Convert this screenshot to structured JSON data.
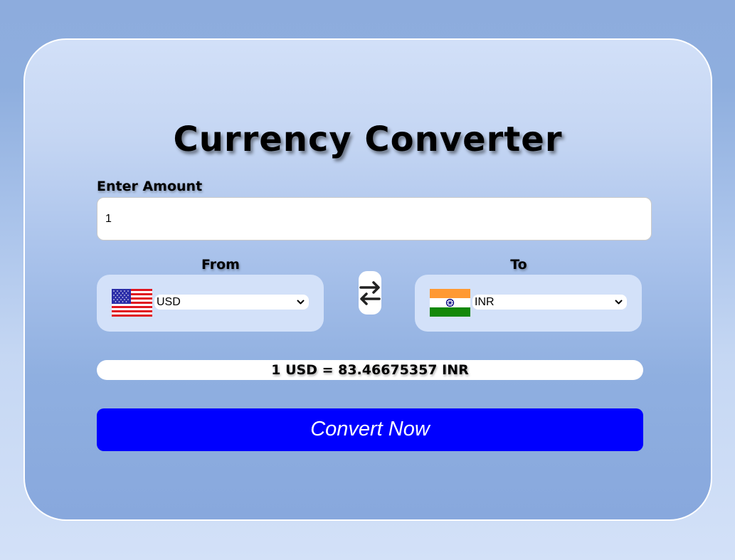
{
  "app": {
    "title": "Currency Converter"
  },
  "amount": {
    "label": "Enter Amount",
    "value": "1"
  },
  "from": {
    "label": "From",
    "currency": "USD",
    "flag_icon": "us-flag-icon"
  },
  "to": {
    "label": "To",
    "currency": "INR",
    "flag_icon": "india-flag-icon"
  },
  "swap": {
    "icon": "swap-arrows-icon"
  },
  "result": {
    "text": "1 USD = 83.46675357 INR"
  },
  "convert": {
    "label": "Convert Now"
  },
  "colors": {
    "button_bg": "#0000ff",
    "card_border": "#ffffff",
    "currency_box_bg": "#d3e1f9"
  }
}
